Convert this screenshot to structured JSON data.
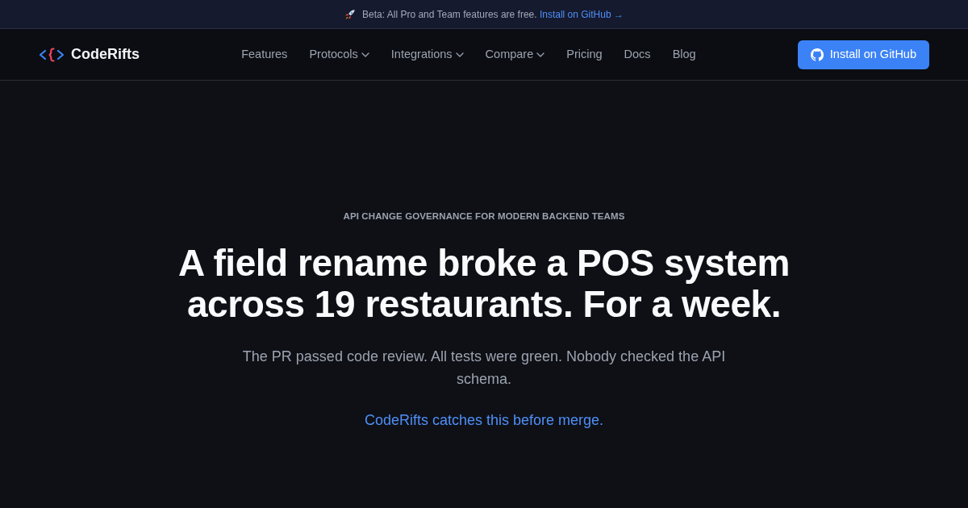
{
  "announcement": {
    "text": "Beta: All Pro and Team features are free.",
    "link": "Install on GitHub →"
  },
  "navbar": {
    "brand": "CodeRifts",
    "links": [
      {
        "label": "Features",
        "dropdown": false
      },
      {
        "label": "Protocols",
        "dropdown": true
      },
      {
        "label": "Integrations",
        "dropdown": true
      },
      {
        "label": "Compare",
        "dropdown": true
      },
      {
        "label": "Pricing",
        "dropdown": false
      },
      {
        "label": "Docs",
        "dropdown": false
      },
      {
        "label": "Blog",
        "dropdown": false
      }
    ],
    "cta": "Install on GitHub"
  },
  "hero": {
    "eyebrow": "API CHANGE GOVERNANCE FOR MODERN BACKEND TEAMS",
    "headline": "A field rename broke a POS system across 19 restaurants. For a week.",
    "subtitle": "The PR passed code review. All tests were green. Nobody checked the API schema.",
    "highlight": "CodeRifts catches this before merge."
  }
}
